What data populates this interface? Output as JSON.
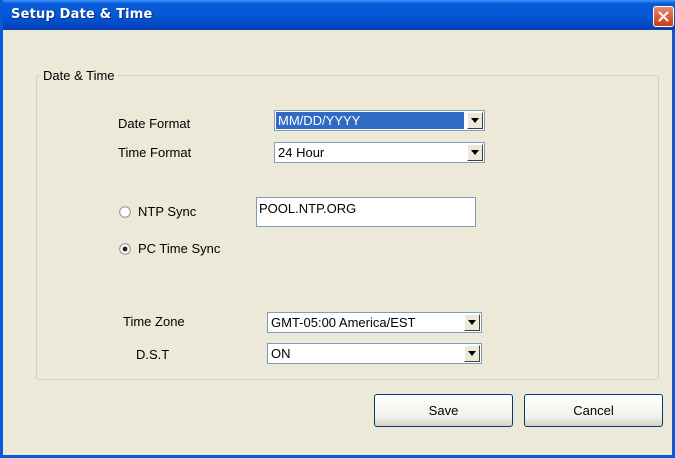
{
  "window": {
    "title": "Setup Date & Time"
  },
  "group": {
    "title": "Date & Time"
  },
  "date_format": {
    "label": "Date Format",
    "selected": "MM/DD/YYYY"
  },
  "time_format": {
    "label": "Time Format",
    "selected": "24 Hour"
  },
  "ntp_sync": {
    "label": "NTP Sync",
    "server": "POOL.NTP.ORG",
    "checked": false
  },
  "pc_sync": {
    "label": "PC Time Sync",
    "checked": true
  },
  "time_zone": {
    "label": "Time Zone",
    "selected": "GMT-05:00 America/EST"
  },
  "dst": {
    "label": "D.S.T",
    "selected": "ON"
  },
  "buttons": {
    "save": "Save",
    "cancel": "Cancel"
  },
  "icons": {
    "close": "close-icon",
    "dropdown": "chevron-down-icon",
    "radio": "radio-button"
  },
  "colors": {
    "title_bar": "#0458D6",
    "dialog_bg": "#ECE9D8",
    "selection": "#316AC5",
    "close_button": "#C83B12"
  }
}
